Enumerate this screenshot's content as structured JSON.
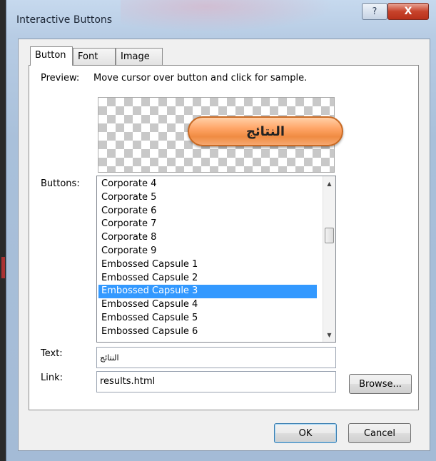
{
  "window": {
    "title": "Interactive Buttons",
    "help_glyph": "?",
    "close_glyph": "X"
  },
  "tabs": [
    {
      "label": "Button",
      "active": true
    },
    {
      "label": "Font",
      "active": false
    },
    {
      "label": "Image",
      "active": false
    }
  ],
  "preview": {
    "label": "Preview:",
    "hint": "Move cursor over button and click for sample.",
    "sample_text": "النتائج"
  },
  "buttons_list": {
    "label": "Buttons:",
    "items": [
      "Corporate 4",
      "Corporate 5",
      "Corporate 6",
      "Corporate 7",
      "Corporate 8",
      "Corporate 9",
      "Embossed Capsule 1",
      "Embossed Capsule 2",
      "Embossed Capsule 3",
      "Embossed Capsule 4",
      "Embossed Capsule 5",
      "Embossed Capsule 6"
    ],
    "selected": "Embossed Capsule 3"
  },
  "text_field": {
    "label": "Text:",
    "value": "النتائج"
  },
  "link_field": {
    "label": "Link:",
    "value": "results.html"
  },
  "browse_label": "Browse...",
  "ok_label": "OK",
  "cancel_label": "Cancel",
  "colors": {
    "selection": "#3399ff",
    "sample_button": "#ffa466",
    "close_button": "#c7432b"
  }
}
